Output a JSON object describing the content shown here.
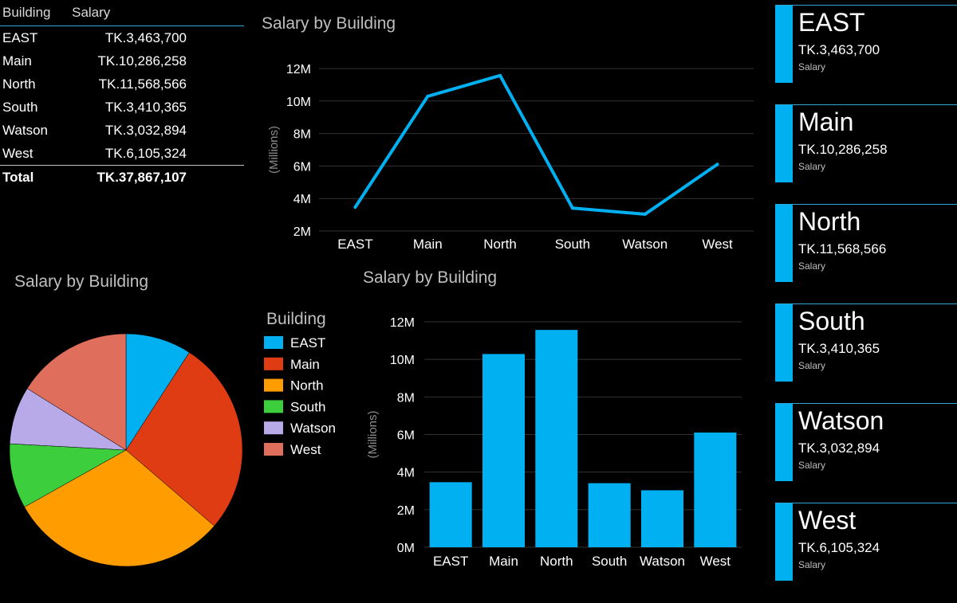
{
  "table": {
    "headers": [
      "Building",
      "Salary"
    ],
    "rows": [
      {
        "building": "EAST",
        "salary": "TK.3,463,700"
      },
      {
        "building": "Main",
        "salary": "TK.10,286,258"
      },
      {
        "building": "North",
        "salary": "TK.11,568,566"
      },
      {
        "building": "South",
        "salary": "TK.3,410,365"
      },
      {
        "building": "Watson",
        "salary": "TK.3,032,894"
      },
      {
        "building": "West",
        "salary": "TK.6,105,324"
      }
    ],
    "total_label": "Total",
    "total_value": "TK.37,867,107"
  },
  "chart_data": [
    {
      "type": "line",
      "title": "Salary by Building",
      "categories": [
        "EAST",
        "Main",
        "North",
        "South",
        "Watson",
        "West"
      ],
      "values": [
        3463700,
        10286258,
        11568566,
        3410365,
        3032894,
        6105324
      ],
      "ylabel": "(Millions)",
      "ylim": [
        2000000,
        12000000
      ],
      "yticks": [
        "2M",
        "4M",
        "6M",
        "8M",
        "10M",
        "12M"
      ],
      "color": "#00b0f0",
      "grid": true
    },
    {
      "type": "pie",
      "title": "Salary by Building",
      "legend_title": "Building",
      "legend_position": "right",
      "categories": [
        "EAST",
        "Main",
        "North",
        "South",
        "Watson",
        "West"
      ],
      "values": [
        3463700,
        10286258,
        11568566,
        3410365,
        3032894,
        6105324
      ],
      "colors": [
        "#00b0f0",
        "#e03c14",
        "#ff9c00",
        "#3cce3c",
        "#b8a9e8",
        "#e06e5c"
      ]
    },
    {
      "type": "bar",
      "title": "Salary by Building",
      "categories": [
        "EAST",
        "Main",
        "North",
        "South",
        "Watson",
        "West"
      ],
      "values": [
        3463700,
        10286258,
        11568566,
        3410365,
        3032894,
        6105324
      ],
      "ylabel": "(Millions)",
      "ylim": [
        0,
        12000000
      ],
      "yticks": [
        "0M",
        "2M",
        "4M",
        "6M",
        "8M",
        "10M",
        "12M"
      ],
      "color": "#00b0f0",
      "grid": true
    }
  ],
  "cards": [
    {
      "name": "EAST",
      "value": "TK.3,463,700",
      "label": "Salary"
    },
    {
      "name": "Main",
      "value": "TK.10,286,258",
      "label": "Salary"
    },
    {
      "name": "North",
      "value": "TK.11,568,566",
      "label": "Salary"
    },
    {
      "name": "South",
      "value": "TK.3,410,365",
      "label": "Salary"
    },
    {
      "name": "Watson",
      "value": "TK.3,032,894",
      "label": "Salary"
    },
    {
      "name": "West",
      "value": "TK.6,105,324",
      "label": "Salary"
    }
  ],
  "colors": {
    "accent": "#00b0f0",
    "background": "#000000"
  }
}
